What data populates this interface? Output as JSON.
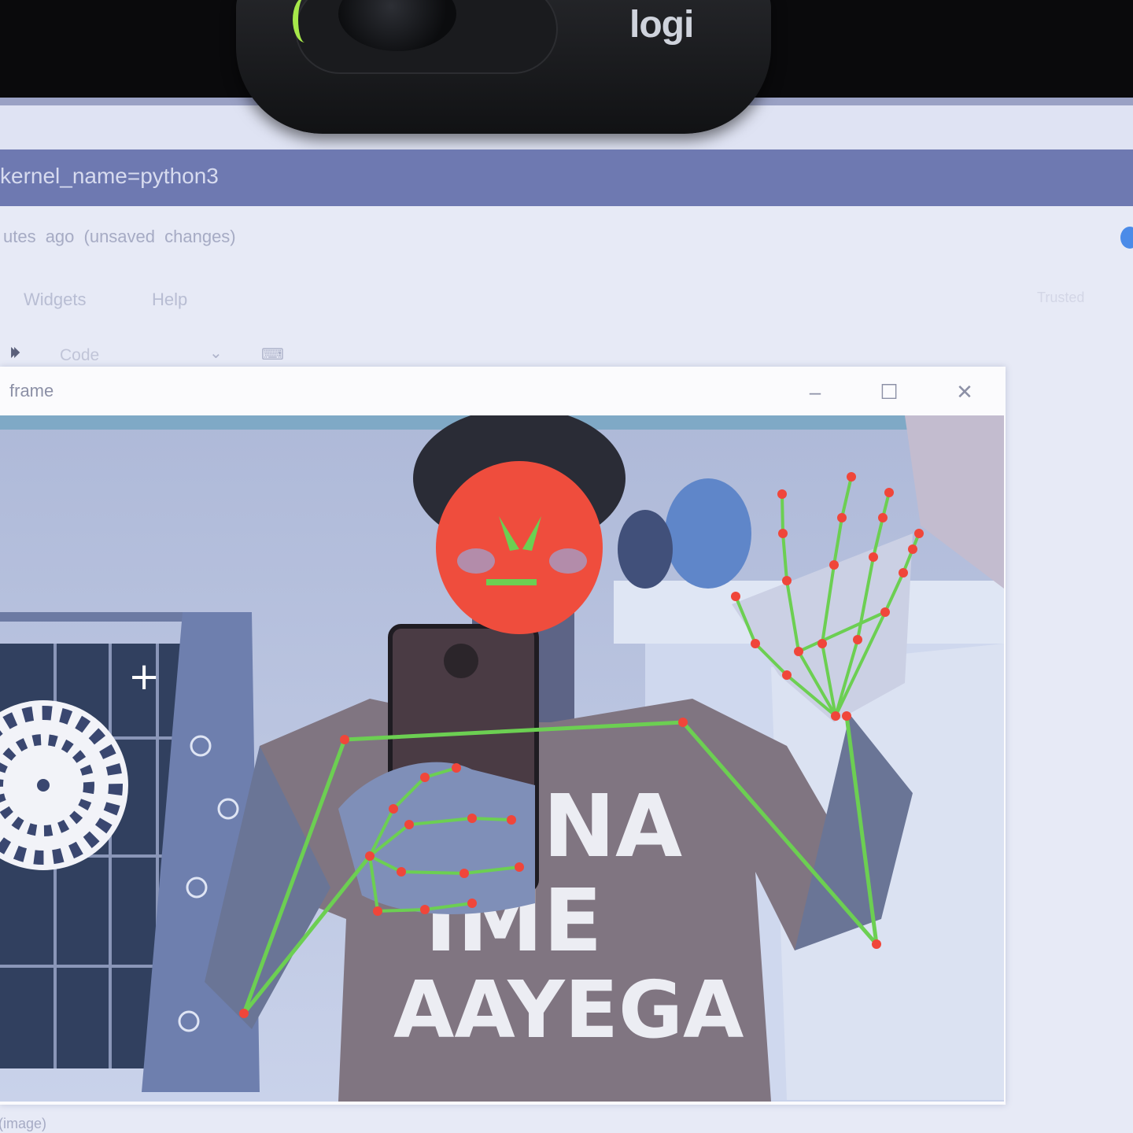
{
  "webcam": {
    "brand": "logi"
  },
  "notebook": {
    "kernel_text": "kernel_name=python3",
    "save_status": "utes ago  (unsaved changes)",
    "menu": [
      "Widgets",
      "Help"
    ],
    "trusted_label": "Trusted",
    "toolbar": {
      "run_all_icon": "⏵⏵",
      "cell_type": "Code",
      "keyboard_icon": "⌨"
    },
    "bottom_text": "(image)"
  },
  "cv_window": {
    "title": "frame",
    "buttons": {
      "minimize": "–",
      "maximize": "☐",
      "close": "✕"
    }
  },
  "feed": {
    "shirt_lines": [
      "NA",
      "IME",
      "AAYEGA"
    ],
    "colors": {
      "landmark": "#f0463a",
      "connector": "#6ccf52",
      "face_mask": "#ef4d3d"
    }
  }
}
